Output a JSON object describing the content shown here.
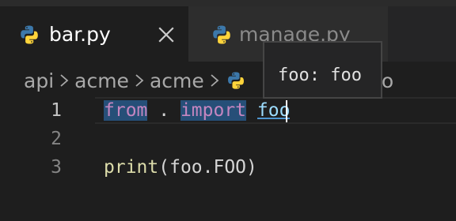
{
  "tabs": [
    {
      "label": "bar.py",
      "icon": "python-icon",
      "active": true,
      "closable": true
    },
    {
      "label": "manage.py",
      "icon": "python-icon",
      "active": false
    }
  ],
  "breadcrumbs": {
    "items": [
      "api",
      "acme",
      "acme"
    ],
    "separator_icon": "chevron-right-icon",
    "file_icon": "python-icon",
    "file_label": "foo"
  },
  "code": {
    "lines": [
      {
        "number": "1",
        "tokens": {
          "kw1": "from",
          "dot": " . ",
          "kw2": "import",
          "sp": " ",
          "sym": "foo"
        }
      },
      {
        "number": "2"
      },
      {
        "number": "3",
        "tokens": {
          "fn": "print",
          "rest": "(foo.FOO)"
        }
      }
    ]
  },
  "hover": {
    "text": "foo: foo"
  },
  "colors": {
    "keyword": "#c586c0",
    "function": "#dcdcaa",
    "identifier": "#9cdcfe",
    "background": "#1e1e1e",
    "python_blue": "#3c78aa",
    "python_yellow": "#ffd43b"
  }
}
